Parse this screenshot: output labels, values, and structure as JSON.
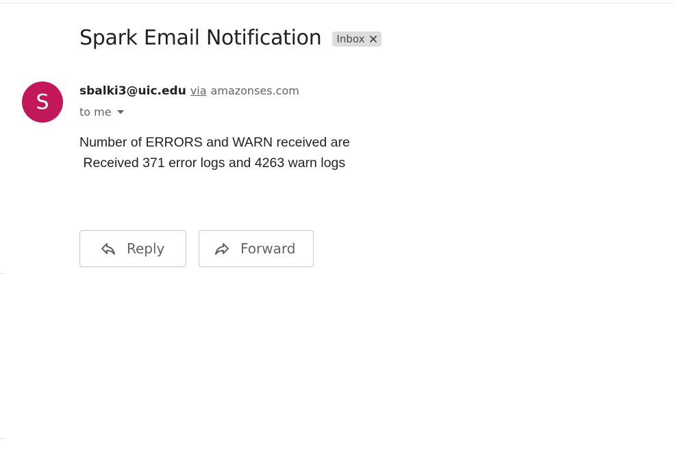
{
  "email": {
    "subject": "Spark Email Notification",
    "label": "Inbox",
    "label_close_icon": "close-icon",
    "sender": {
      "avatar_letter": "S",
      "avatar_color": "#c2185b",
      "email": "sbalki3@uic.edu",
      "via_text": "via",
      "via_domain": "amazonses.com"
    },
    "recipient_text": "to me",
    "recipient_toggle_icon": "caret-down-icon",
    "body_lines": [
      "Number of ERRORS and WARN received are",
      " Received 371 error logs and 4263 warn logs"
    ]
  },
  "actions": {
    "reply_label": "Reply",
    "reply_icon": "reply-arrow-icon",
    "forward_label": "Forward",
    "forward_icon": "forward-arrow-icon"
  }
}
